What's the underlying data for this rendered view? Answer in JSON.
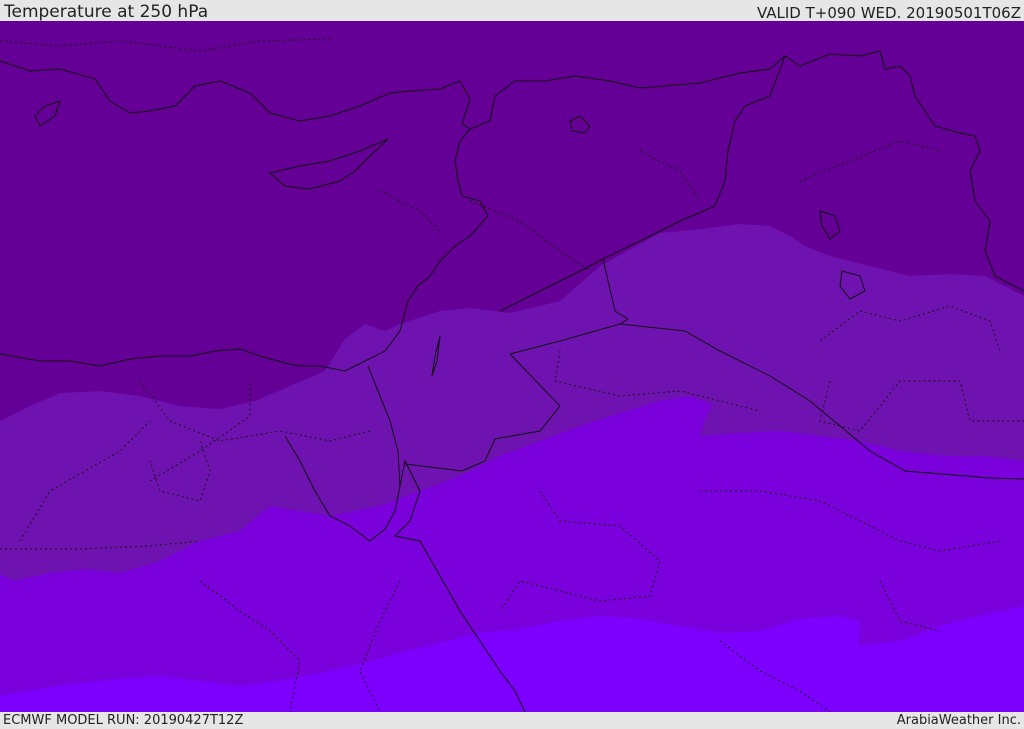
{
  "header": {
    "title": "Temperature at 250 hPa",
    "valid": "VALID T+090 WED. 20190501T06Z"
  },
  "footer": {
    "model_run": "ECMWF MODEL RUN: 20190427T12Z",
    "credit": "ArabiaWeather Inc."
  },
  "map": {
    "temperature_bands": [
      {
        "name": "coldest",
        "color": "#640096"
      },
      {
        "name": "cool",
        "color": "#6e12b0"
      },
      {
        "name": "mid",
        "color": "#7a00dc"
      },
      {
        "name": "warm",
        "color": "#7d00ff"
      }
    ],
    "line_color": "#111111"
  }
}
